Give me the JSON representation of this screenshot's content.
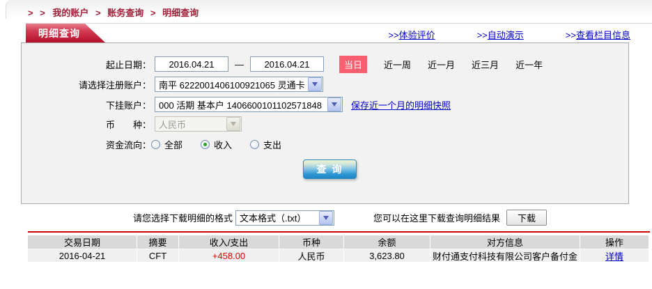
{
  "breadcrumb": {
    "prefix": "> >",
    "separator": ">",
    "items": [
      "我的账户",
      "账务查询",
      "明细查询"
    ]
  },
  "panel": {
    "tab_title": "明细查询",
    "links": [
      {
        "prefix": ">>",
        "label": "体验评价"
      },
      {
        "prefix": ">>",
        "label": "自动演示"
      },
      {
        "prefix": ">>",
        "label": "查看栏目信息"
      }
    ]
  },
  "form": {
    "date_label": "起止日期：",
    "date_from": "2016.04.21",
    "date_separator": "—",
    "date_to": "2016.04.21",
    "quick": {
      "today": "当日",
      "ranges": [
        "近一周",
        "近一月",
        "近三月",
        "近一年"
      ]
    },
    "register": {
      "label": "请选择注册账户：",
      "value": "南平 6222001406100921065 灵通卡"
    },
    "sub": {
      "label": "下挂账户：",
      "value": "000 活期 基本户 1406600101102571848",
      "snapshot_link": "保存近一个月的明细快照"
    },
    "currency": {
      "label": "币　　种：",
      "value": "人民币"
    },
    "flow": {
      "label": "资金流向：",
      "options": [
        {
          "label": "全部",
          "checked": false
        },
        {
          "label": "收入",
          "checked": true
        },
        {
          "label": "支出",
          "checked": false
        }
      ]
    },
    "query_button": "查 询"
  },
  "download": {
    "format_label": "请您选择下载明细的格式",
    "format_value": "文本格式（.txt）",
    "hint": "您可以在这里下载查询明细结果",
    "button_label": "下载"
  },
  "table": {
    "headers": [
      "交易日期",
      "摘要",
      "收入/支出",
      "币种",
      "余额",
      "对方信息",
      "操作"
    ],
    "rows": [
      {
        "date": "2016-04-21",
        "summary": "CFT",
        "amount": "+458.00",
        "currency": "人民币",
        "balance": "3,623.80",
        "counterparty": "财付通支付科技有限公司客户备付金",
        "action": "详情"
      }
    ]
  },
  "colors": {
    "tab_red": "#b30d28",
    "breadcrumb_red": "#a11f38",
    "badge_red": "#fa5f6f",
    "link_blue": "#0000cc",
    "amount_red": "#e00000",
    "button_blue": "#1e86c4",
    "divider_red": "#cc0000"
  }
}
